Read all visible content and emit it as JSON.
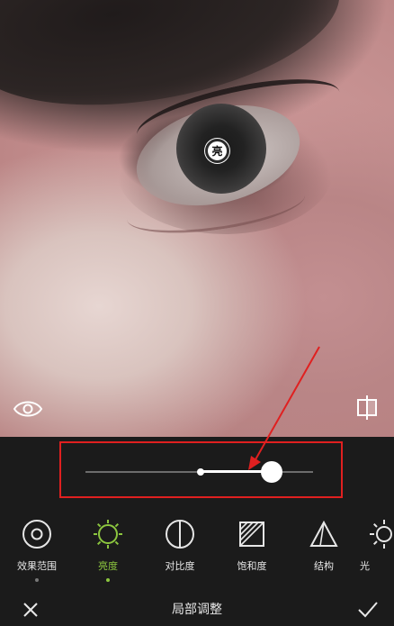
{
  "photo": {
    "point_marker_label": "亮"
  },
  "slider": {
    "value_fraction": 0.82,
    "center_fraction": 0.5
  },
  "tools": [
    {
      "label": "效果范围",
      "icon": "effect-range-icon",
      "active": false
    },
    {
      "label": "亮度",
      "icon": "brightness-icon",
      "active": true
    },
    {
      "label": "对比度",
      "icon": "contrast-icon",
      "active": false
    },
    {
      "label": "饱和度",
      "icon": "saturation-icon",
      "active": false
    },
    {
      "label": "结构",
      "icon": "structure-icon",
      "active": false
    },
    {
      "label": "光",
      "icon": "light-icon",
      "active": false
    }
  ],
  "bottom_bar": {
    "title": "局部调整"
  },
  "colors": {
    "accent": "#8cc63f",
    "annotation": "#e02020",
    "panel_bg": "#1b1b1b"
  }
}
